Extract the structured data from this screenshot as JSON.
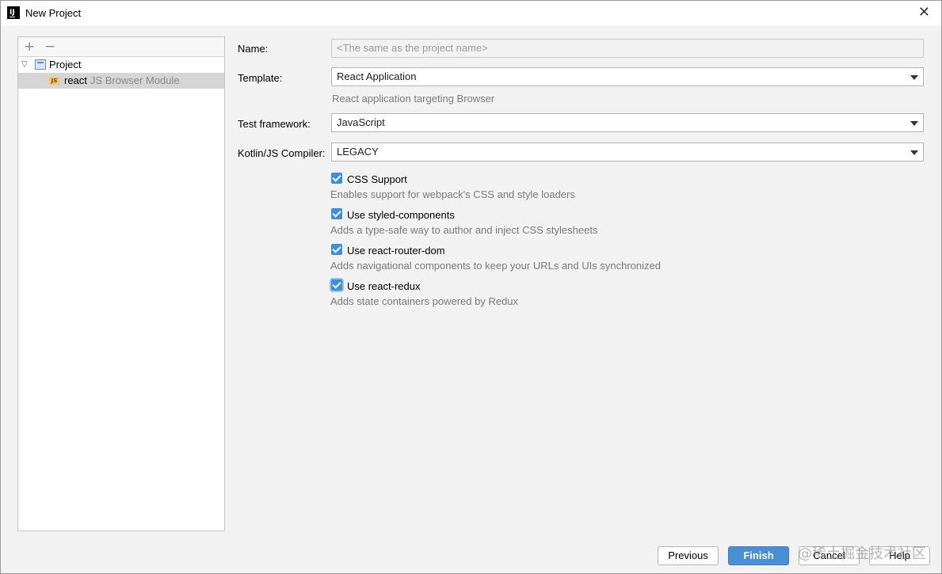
{
  "window": {
    "app_icon_text": "IJ",
    "title": "New Project",
    "close_glyph": "✕"
  },
  "tree": {
    "add_glyph": "+",
    "remove_glyph": "−",
    "root": {
      "label": "Project",
      "expanded": true,
      "chevron": "▽"
    },
    "module": {
      "icon_text": "JS",
      "label": "react",
      "sublabel": "JS Browser Module",
      "selected": true
    }
  },
  "form": {
    "name": {
      "label": "Name:",
      "placeholder": "<The same as the project name>"
    },
    "template": {
      "label": "Template:",
      "value": "React Application",
      "hint": "React application targeting Browser"
    },
    "test_framework": {
      "label": "Test framework:",
      "value": "JavaScript"
    },
    "compiler": {
      "label": "Kotlin/JS Compiler:",
      "value": "LEGACY"
    },
    "options": [
      {
        "label": "CSS Support",
        "hint": "Enables support for webpack's CSS and style loaders",
        "checked": true
      },
      {
        "label": "Use styled-components",
        "hint": "Adds a type-safe way to author and inject CSS stylesheets",
        "checked": true
      },
      {
        "label": "Use react-router-dom",
        "hint": "Adds navigational components to keep your URLs and UIs synchronized",
        "checked": true
      },
      {
        "label": "Use react-redux",
        "hint": "Adds state containers powered by Redux",
        "checked": true
      }
    ]
  },
  "buttons": {
    "previous": "Previous",
    "finish": "Finish",
    "cancel": "Cancel",
    "help": "Help"
  },
  "watermark": "@稀土掘金技术社区",
  "colors": {
    "accent": "#4a8fd6",
    "checkbox": "#3d8edb",
    "selection": "#d5d5d5"
  }
}
